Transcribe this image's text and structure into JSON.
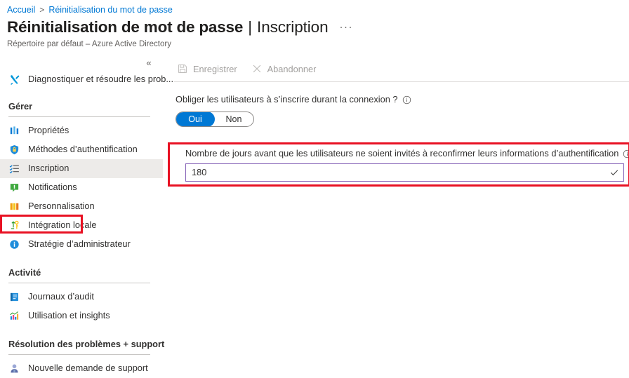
{
  "breadcrumb": {
    "home": "Accueil",
    "separator": ">",
    "current": "Réinitialisation du mot de passe"
  },
  "header": {
    "title": "Réinitialisation de mot de passe",
    "pipe": "|",
    "section": "Inscription",
    "more_label": "···",
    "subtitle": "Répertoire par défaut – Azure Active Directory"
  },
  "sidebar": {
    "collapse_label": "«",
    "top_items": [
      {
        "label": "Diagnostiquer et résoudre les prob...",
        "icon": "wrench-icon"
      }
    ],
    "groups": [
      {
        "title": "Gérer",
        "items": [
          {
            "label": "Propriétés",
            "icon": "properties-icon",
            "selected": false
          },
          {
            "label": "Méthodes d’authentification",
            "icon": "shield-lock-icon",
            "selected": false
          },
          {
            "label": "Inscription",
            "icon": "registration-list-icon",
            "selected": true
          },
          {
            "label": "Notifications",
            "icon": "notification-icon",
            "selected": false
          },
          {
            "label": "Personnalisation",
            "icon": "customization-icon",
            "selected": false
          },
          {
            "label": "Intégration locale",
            "icon": "on-premises-integration-icon",
            "selected": false
          },
          {
            "label": "Stratégie d’administrateur",
            "icon": "info-circle-icon",
            "selected": false
          }
        ]
      },
      {
        "title": "Activité",
        "items": [
          {
            "label": "Journaux d’audit",
            "icon": "audit-log-icon",
            "selected": false
          },
          {
            "label": "Utilisation et insights",
            "icon": "usage-insights-icon",
            "selected": false
          }
        ]
      },
      {
        "title": "Résolution des problèmes + support",
        "items": [
          {
            "label": "Nouvelle demande de support",
            "icon": "support-person-icon",
            "selected": false
          }
        ]
      }
    ]
  },
  "toolbar": {
    "save_label": "Enregistrer",
    "discard_label": "Abandonner"
  },
  "form": {
    "require_registration": {
      "label": "Obliger les utilisateurs à s’inscrire durant la connexion ?",
      "info_tooltip": "i",
      "options": [
        "Oui",
        "Non"
      ],
      "value": "Oui"
    },
    "days_before_reconfirm": {
      "label": "Nombre de jours avant que les utilisateurs ne soient invités à reconfirmer leurs informations d’authentification",
      "info_tooltip": "i",
      "value": "180",
      "placeholder": "",
      "valid_icon": "checkmark-icon"
    }
  },
  "colors": {
    "accent": "#0078d4",
    "link": "#0078d4",
    "annotation": "#e81123",
    "input_border": "#8764b8",
    "selected_bg": "#edebe9"
  }
}
